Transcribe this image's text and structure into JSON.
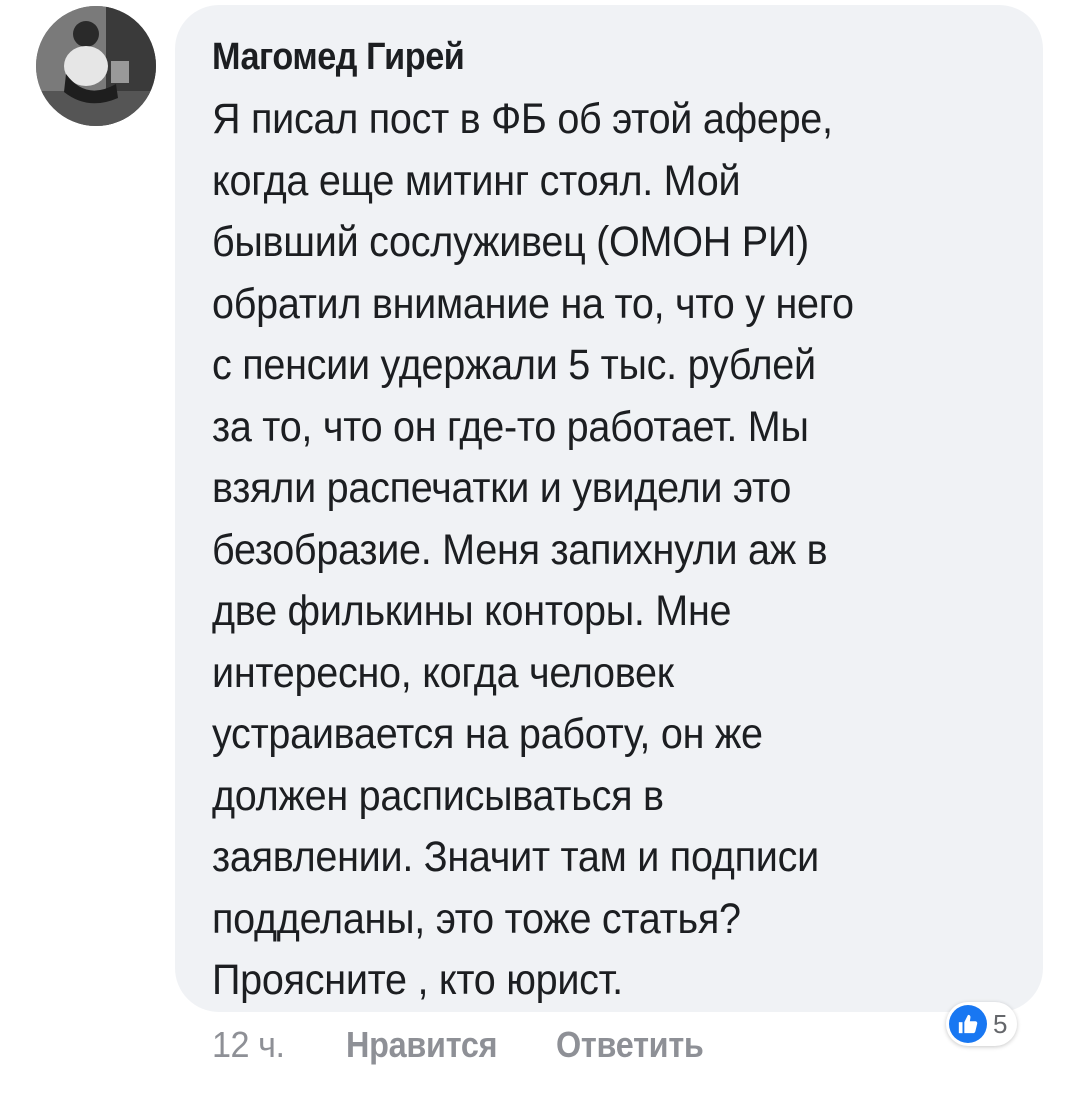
{
  "comment": {
    "author": "Магомед Гирей",
    "text_lines": [
      "Я писал пост в ФБ об этой афере,",
      "когда еще митинг стоял. Мой",
      "бывший сослуживец (ОМОН РИ)",
      "обратил внимание на то, что у него",
      "с пенсии удержали 5 тыс. рублей",
      "за то, что он где-то работает. Мы",
      "взяли распечатки и увидели это",
      "безобразие. Меня запихнули аж в",
      "две филькины конторы. Мне",
      "интересно, когда человек",
      "устраивается на работу, он же",
      "должен расписываться в",
      "заявлении. Значит там и подписи",
      "подделаны, это тоже статья?",
      "Проясните , кто юрист."
    ],
    "time": "12 ч.",
    "like_label": "Нравится",
    "reply_label": "Ответить",
    "reaction": {
      "icon": "thumbs-up-icon",
      "count": "5"
    }
  },
  "colors": {
    "bubble": "#f0f2f5",
    "text": "#1c1e21",
    "muted": "#8e9096",
    "like_blue": "#1877f2"
  }
}
